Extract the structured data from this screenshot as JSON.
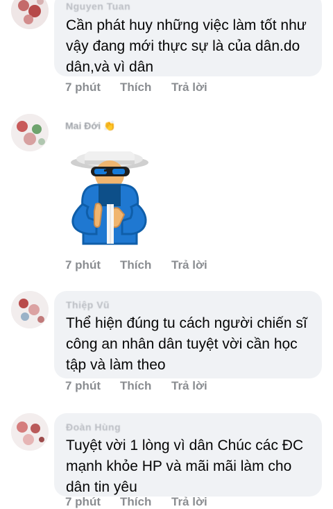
{
  "comments": [
    {
      "author": "Nguyen Tuan",
      "text": "Cần phát huy những việc làm tốt như vậy đang mới thực sự là của dân.do dân,và vì dân",
      "time": "7 phút",
      "like": "Thích",
      "reply": "Trả lời"
    },
    {
      "author": "Mai Đới",
      "time": "7 phút",
      "like": "Thích",
      "reply": "Trả lời"
    },
    {
      "author": "Thiệp Vũ",
      "text": "Thể hiện đúng tu cách người chiến sĩ công an nhân dân tuyệt vời cần học tập và làm theo",
      "time": "7 phút",
      "like": "Thích",
      "reply": "Trả lời"
    },
    {
      "author": "Đoàn Hùng",
      "text": "Tuyệt vời 1 lòng vì dân Chúc các ĐC mạnh khỏe HP và mãi mãi làm cho dân tin yêu",
      "time": "7 phút",
      "like": "Thích",
      "reply": "Trả lời"
    }
  ],
  "colors": {
    "bubble": "#f0f2f5",
    "meta": "#8a8d91",
    "text": "#050505",
    "sticker_jacket": "#1f78d1",
    "sticker_hat": "#e8e8e8"
  },
  "icons": [
    "avatar",
    "clapping-hands-icon",
    "clapping-sticker"
  ]
}
